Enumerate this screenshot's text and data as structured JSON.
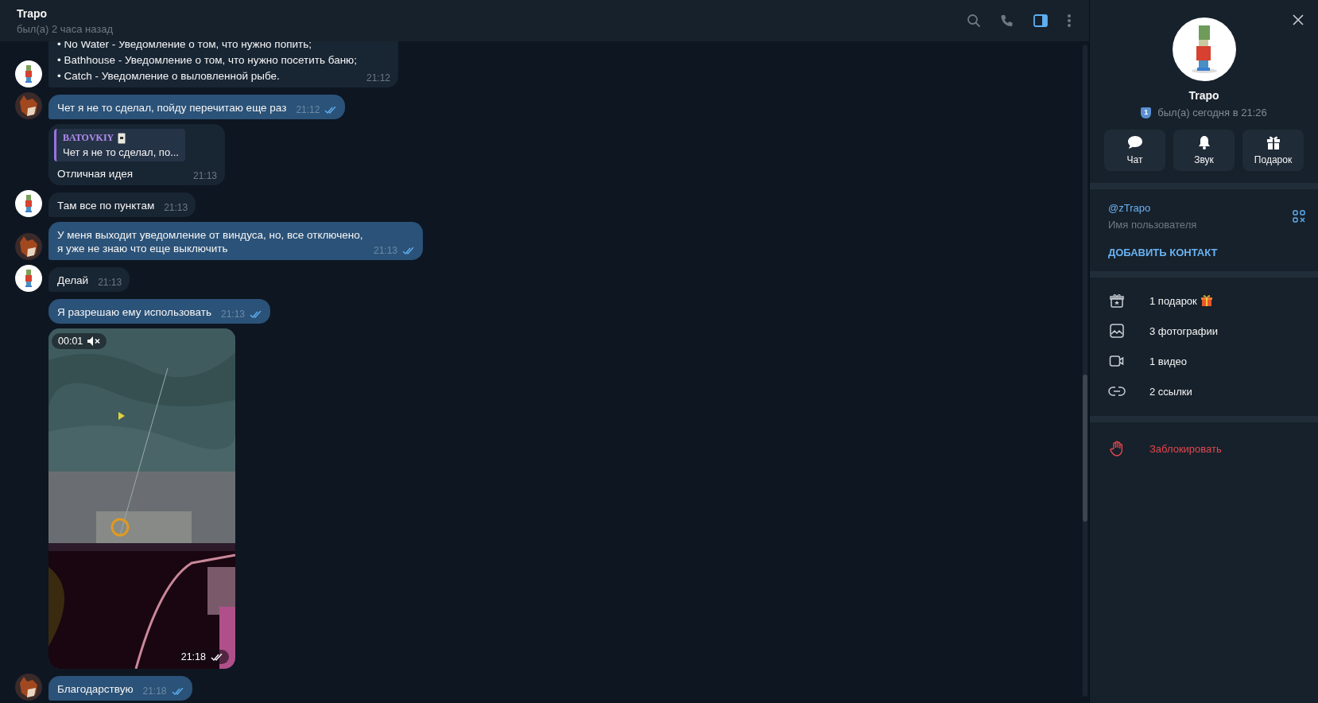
{
  "header": {
    "name": "Trapo",
    "status": "был(а) 2 часа назад",
    "profile_panel_selected": true
  },
  "messages": [
    {
      "kind": "text",
      "outgoing": false,
      "avatar": true,
      "read": false,
      "lines": [
        "• No Water - Уведомление о том, что нужно попить;",
        "• Bathhouse - Уведомление о том, что нужно посетить баню;",
        "• Catch - Уведомление о выловленной рыбе."
      ],
      "time": "21:12"
    },
    {
      "kind": "text",
      "outgoing": true,
      "avatar": true,
      "read": true,
      "lines": [
        "Чет я не то сделал, пойду перечитаю еще раз"
      ],
      "time": "21:12"
    },
    {
      "kind": "text",
      "outgoing": false,
      "avatar": false,
      "read": false,
      "reply": {
        "author": "BATOVKIY",
        "text": "Чет я не то сделал, по..."
      },
      "lines": [
        "Отличная идея"
      ],
      "time": "21:13"
    },
    {
      "kind": "text",
      "outgoing": false,
      "avatar": true,
      "read": false,
      "lines": [
        "Там все по пунктам"
      ],
      "time": "21:13"
    },
    {
      "kind": "text",
      "outgoing": true,
      "avatar": true,
      "read": true,
      "lines": [
        "У меня выходит уведомление от виндуса, но, все отключено, я уже не знаю что еще выключить"
      ],
      "time": "21:13"
    },
    {
      "kind": "text",
      "outgoing": false,
      "avatar": true,
      "read": false,
      "lines": [
        "Делай"
      ],
      "time": "21:13"
    },
    {
      "kind": "text",
      "outgoing": true,
      "avatar": false,
      "read": true,
      "lines": [
        "Я разрешаю ему использовать"
      ],
      "time": "21:13"
    },
    {
      "kind": "video",
      "outgoing": true,
      "avatar": false,
      "read": true,
      "duration": "00:01",
      "muted": true,
      "time": "21:18"
    },
    {
      "kind": "text",
      "outgoing": true,
      "avatar": true,
      "read": true,
      "lines": [
        "Благодарствую"
      ],
      "time": "21:18"
    }
  ],
  "profile": {
    "name": "Trapo",
    "badge": "1",
    "status": "был(а) сегодня в 21:26",
    "actions": [
      {
        "kind": "chat",
        "label": "Чат"
      },
      {
        "kind": "sound",
        "label": "Звук"
      },
      {
        "kind": "gift",
        "label": "Подарок"
      }
    ],
    "username": "@zTrapo",
    "username_label": "Имя пользователя",
    "add_contact": "ДОБАВИТЬ КОНТАКТ",
    "media": [
      {
        "kind": "gift",
        "label": "1 подарок",
        "emoji": true
      },
      {
        "label": "3 фотографии",
        "emoji": false
      },
      {
        "kind": "video",
        "label": "1 видео",
        "emoji": false
      },
      {
        "kind": "link",
        "label": "2 ссылки",
        "emoji": false
      }
    ],
    "block": "Заблокировать"
  }
}
